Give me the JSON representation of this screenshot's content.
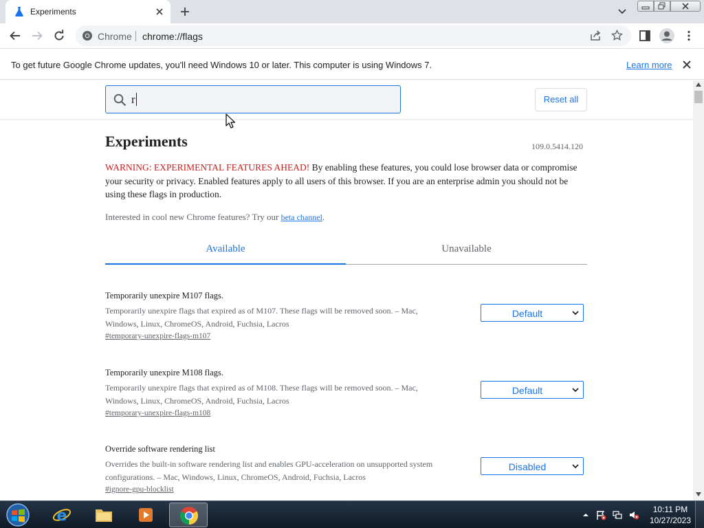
{
  "tab": {
    "title": "Experiments"
  },
  "omnibox": {
    "chip": "Chrome",
    "url": "chrome://flags"
  },
  "infobar": {
    "message": "To get future Google Chrome updates, you'll need Windows 10 or later. This computer is using Windows 7.",
    "link": "Learn more"
  },
  "search": {
    "value": "r"
  },
  "reset_label": "Reset all",
  "page": {
    "title": "Experiments",
    "version": "109.0.5414.120",
    "warning_head": "WARNING: EXPERIMENTAL FEATURES AHEAD!",
    "warning_body": " By enabling these features, you could lose browser data or compromise your security or privacy. Enabled features apply to all users of this browser. If you are an enterprise admin you should not be using these flags in production.",
    "interest_text": "Interested in cool new Chrome features? Try our ",
    "interest_link": "beta channel",
    "interest_end": "."
  },
  "tabs": {
    "available": "Available",
    "unavailable": "Unavailable"
  },
  "flags": [
    {
      "name": "Temporarily unexpire M107 flags.",
      "description": "Temporarily unexpire flags that expired as of M107. These flags will be removed soon. – Mac, Windows, Linux, ChromeOS, Android, Fuchsia, Lacros",
      "hash": "#temporary-unexpire-flags-m107",
      "value": "Default"
    },
    {
      "name": "Temporarily unexpire M108 flags.",
      "description": "Temporarily unexpire flags that expired as of M108. These flags will be removed soon. – Mac, Windows, Linux, ChromeOS, Android, Fuchsia, Lacros",
      "hash": "#temporary-unexpire-flags-m108",
      "value": "Default"
    },
    {
      "name": "Override software rendering list",
      "description": "Overrides the built-in software rendering list and enables GPU-acceleration on unsupported system configurations. – Mac, Windows, Linux, ChromeOS, Android, Fuchsia, Lacros",
      "hash": "#ignore-gpu-blocklist",
      "value": "Disabled"
    }
  ],
  "taskbar": {
    "time": "10:11 PM",
    "date": "10/27/2023"
  },
  "colors": {
    "accent": "#1a73e8",
    "warning": "#c5221f",
    "tabstrip": "#dee1e6"
  }
}
